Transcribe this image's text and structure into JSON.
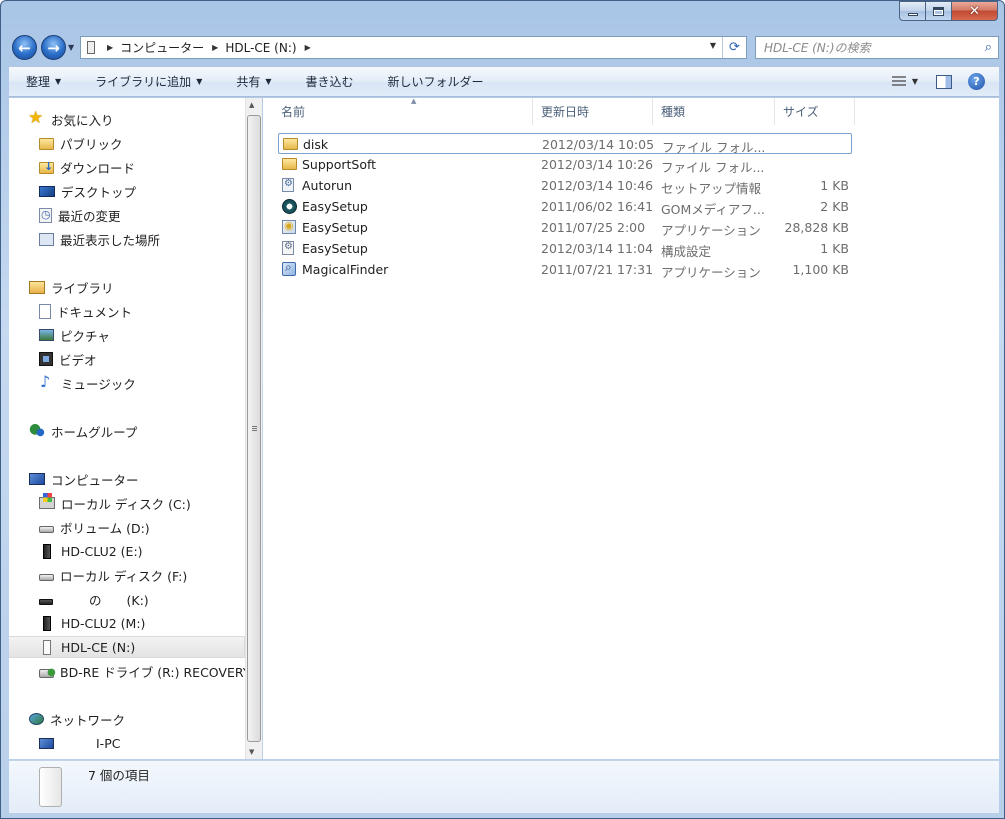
{
  "window": {
    "caption_buttons": [
      "minimize",
      "maximize",
      "close"
    ]
  },
  "address_bar": {
    "crumbs": [
      "コンピューター",
      "HDL-CE (N:)"
    ]
  },
  "search": {
    "placeholder": "HDL-CE (N:)の検索"
  },
  "toolbar": {
    "commands": [
      {
        "label": "整理",
        "dropdown": true
      },
      {
        "label": "ライブラリに追加",
        "dropdown": true
      },
      {
        "label": "共有",
        "dropdown": true
      },
      {
        "label": "書き込む",
        "dropdown": false
      },
      {
        "label": "新しいフォルダー",
        "dropdown": false
      }
    ]
  },
  "nav": {
    "favorites": {
      "label": "お気に入り",
      "items": [
        "パブリック",
        "ダウンロード",
        "デスクトップ",
        "最近の変更",
        "最近表示した場所"
      ]
    },
    "libraries": {
      "label": "ライブラリ",
      "items": [
        "ドキュメント",
        "ピクチャ",
        "ビデオ",
        "ミュージック"
      ]
    },
    "homegroup": {
      "label": "ホームグループ"
    },
    "computer": {
      "label": "コンピューター",
      "items": [
        "ローカル ディスク (C:)",
        "ボリューム (D:)",
        "HD-CLU2 (E:)",
        "ローカル ディスク (F:)",
        "の　　(K:)",
        "HD-CLU2 (M:)",
        "HDL-CE (N:)",
        "BD-RE ドライブ (R:) RECOVERY"
      ],
      "selected": "HDL-CE (N:)"
    },
    "network": {
      "label": "ネットワーク",
      "items": [
        "I-PC"
      ]
    }
  },
  "columns": {
    "name": "名前",
    "date": "更新日時",
    "type": "種類",
    "size": "サイズ"
  },
  "files": [
    {
      "name": "disk",
      "date": "2012/03/14 10:05",
      "type": "ファイル フォル...",
      "size": "",
      "icon": "folder-icon"
    },
    {
      "name": "SupportSoft",
      "date": "2012/03/14 10:26",
      "type": "ファイル フォル...",
      "size": "",
      "icon": "folder-icon"
    },
    {
      "name": "Autorun",
      "date": "2012/03/14 10:46",
      "type": "セットアップ情報",
      "size": "1 KB",
      "icon": "setup-info-icon"
    },
    {
      "name": "EasySetup",
      "date": "2011/06/02 16:41",
      "type": "GOMメディアフ...",
      "size": "2 KB",
      "icon": "gom-media-icon"
    },
    {
      "name": "EasySetup",
      "date": "2011/07/25 2:00",
      "type": "アプリケーション",
      "size": "28,828 KB",
      "icon": "application-icon"
    },
    {
      "name": "EasySetup",
      "date": "2012/03/14 11:04",
      "type": "構成設定",
      "size": "1 KB",
      "icon": "config-icon"
    },
    {
      "name": "MagicalFinder",
      "date": "2011/07/21 17:31",
      "type": "アプリケーション",
      "size": "1,100 KB",
      "icon": "magical-finder-icon"
    }
  ],
  "status": {
    "count_text": "7 個の項目"
  }
}
